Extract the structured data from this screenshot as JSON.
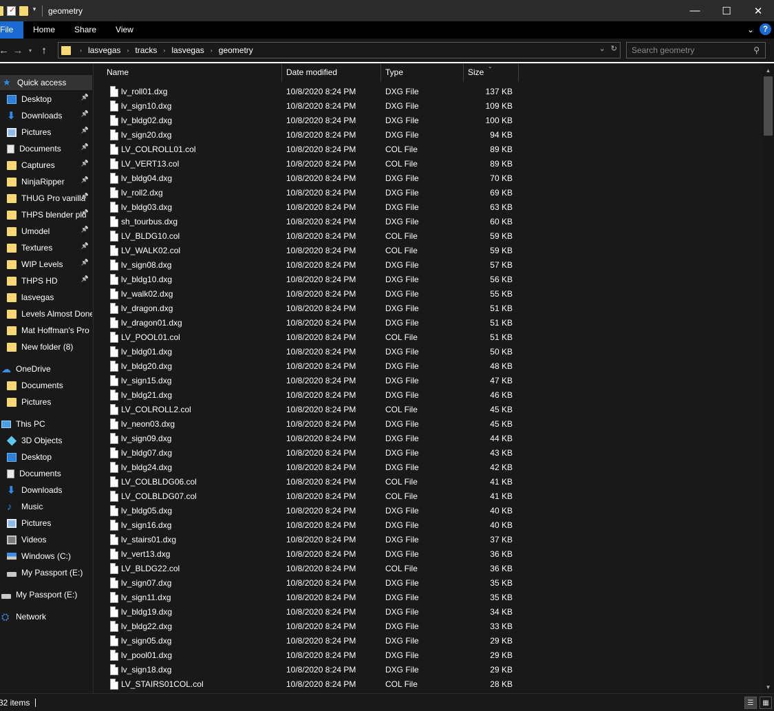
{
  "window": {
    "title": "geometry",
    "controls": {
      "minimize": "—",
      "maximize": "☐",
      "close": "✕"
    }
  },
  "ribbon": {
    "tabs": [
      "File",
      "Home",
      "Share",
      "View"
    ],
    "expand_icon": "chevron-down-icon",
    "help_label": "?"
  },
  "navigation": {
    "breadcrumb": [
      "lasvegas",
      "tracks",
      "lasvegas",
      "geometry"
    ],
    "search_placeholder": "Search geometry"
  },
  "sidebar": {
    "quick_access": {
      "label": "Quick access",
      "items": [
        {
          "label": "Desktop",
          "icon": "desktop",
          "pinned": true
        },
        {
          "label": "Downloads",
          "icon": "down",
          "pinned": true
        },
        {
          "label": "Pictures",
          "icon": "pic",
          "pinned": true
        },
        {
          "label": "Documents",
          "icon": "doc",
          "pinned": true
        },
        {
          "label": "Captures",
          "icon": "folder",
          "pinned": true
        },
        {
          "label": "NinjaRipper",
          "icon": "folder",
          "pinned": true
        },
        {
          "label": "THUG Pro vanilla",
          "icon": "folder",
          "pinned": true
        },
        {
          "label": "THPS blender plu",
          "icon": "folder",
          "pinned": true
        },
        {
          "label": "Umodel",
          "icon": "folder",
          "pinned": true
        },
        {
          "label": "Textures",
          "icon": "folder",
          "pinned": true
        },
        {
          "label": "WIP Levels",
          "icon": "folder",
          "pinned": true
        },
        {
          "label": "THPS HD",
          "icon": "folder",
          "pinned": true
        },
        {
          "label": "lasvegas",
          "icon": "folder",
          "pinned": false
        },
        {
          "label": "Levels Almost Done",
          "icon": "folder",
          "pinned": false
        },
        {
          "label": "Mat Hoffman's Pro",
          "icon": "folder",
          "pinned": false
        },
        {
          "label": "New folder (8)",
          "icon": "folder",
          "pinned": false
        }
      ]
    },
    "onedrive": {
      "label": "OneDrive",
      "items": [
        {
          "label": "Documents",
          "icon": "folder"
        },
        {
          "label": "Pictures",
          "icon": "folder"
        }
      ]
    },
    "this_pc": {
      "label": "This PC",
      "items": [
        {
          "label": "3D Objects",
          "icon": "cube"
        },
        {
          "label": "Desktop",
          "icon": "desktop"
        },
        {
          "label": "Documents",
          "icon": "doc"
        },
        {
          "label": "Downloads",
          "icon": "down"
        },
        {
          "label": "Music",
          "icon": "music"
        },
        {
          "label": "Pictures",
          "icon": "pic"
        },
        {
          "label": "Videos",
          "icon": "video"
        },
        {
          "label": "Windows (C:)",
          "icon": "winc"
        },
        {
          "label": "My Passport (E:)",
          "icon": "drive"
        }
      ]
    },
    "passport": {
      "label": "My Passport (E:)"
    },
    "network": {
      "label": "Network"
    }
  },
  "columns": {
    "name": "Name",
    "date": "Date modified",
    "type": "Type",
    "size": "Size"
  },
  "files": [
    {
      "name": "lv_roll01.dxg",
      "date": "10/8/2020 8:24 PM",
      "type": "DXG File",
      "size": "137 KB"
    },
    {
      "name": "lv_sign10.dxg",
      "date": "10/8/2020 8:24 PM",
      "type": "DXG File",
      "size": "109 KB"
    },
    {
      "name": "lv_bldg02.dxg",
      "date": "10/8/2020 8:24 PM",
      "type": "DXG File",
      "size": "100 KB"
    },
    {
      "name": "lv_sign20.dxg",
      "date": "10/8/2020 8:24 PM",
      "type": "DXG File",
      "size": "94 KB"
    },
    {
      "name": "LV_COLROLL01.col",
      "date": "10/8/2020 8:24 PM",
      "type": "COL File",
      "size": "89 KB"
    },
    {
      "name": "LV_VERT13.col",
      "date": "10/8/2020 8:24 PM",
      "type": "COL File",
      "size": "89 KB"
    },
    {
      "name": "lv_bldg04.dxg",
      "date": "10/8/2020 8:24 PM",
      "type": "DXG File",
      "size": "70 KB"
    },
    {
      "name": "lv_roll2.dxg",
      "date": "10/8/2020 8:24 PM",
      "type": "DXG File",
      "size": "69 KB"
    },
    {
      "name": "lv_bldg03.dxg",
      "date": "10/8/2020 8:24 PM",
      "type": "DXG File",
      "size": "63 KB"
    },
    {
      "name": "sh_tourbus.dxg",
      "date": "10/8/2020 8:24 PM",
      "type": "DXG File",
      "size": "60 KB"
    },
    {
      "name": "LV_BLDG10.col",
      "date": "10/8/2020 8:24 PM",
      "type": "COL File",
      "size": "59 KB"
    },
    {
      "name": "LV_WALK02.col",
      "date": "10/8/2020 8:24 PM",
      "type": "COL File",
      "size": "59 KB"
    },
    {
      "name": "lv_sign08.dxg",
      "date": "10/8/2020 8:24 PM",
      "type": "DXG File",
      "size": "57 KB"
    },
    {
      "name": "lv_bldg10.dxg",
      "date": "10/8/2020 8:24 PM",
      "type": "DXG File",
      "size": "56 KB"
    },
    {
      "name": "lv_walk02.dxg",
      "date": "10/8/2020 8:24 PM",
      "type": "DXG File",
      "size": "55 KB"
    },
    {
      "name": "lv_dragon.dxg",
      "date": "10/8/2020 8:24 PM",
      "type": "DXG File",
      "size": "51 KB"
    },
    {
      "name": "lv_dragon01.dxg",
      "date": "10/8/2020 8:24 PM",
      "type": "DXG File",
      "size": "51 KB"
    },
    {
      "name": "LV_POOL01.col",
      "date": "10/8/2020 8:24 PM",
      "type": "COL File",
      "size": "51 KB"
    },
    {
      "name": "lv_bldg01.dxg",
      "date": "10/8/2020 8:24 PM",
      "type": "DXG File",
      "size": "50 KB"
    },
    {
      "name": "lv_bldg20.dxg",
      "date": "10/8/2020 8:24 PM",
      "type": "DXG File",
      "size": "48 KB"
    },
    {
      "name": "lv_sign15.dxg",
      "date": "10/8/2020 8:24 PM",
      "type": "DXG File",
      "size": "47 KB"
    },
    {
      "name": "lv_bldg21.dxg",
      "date": "10/8/2020 8:24 PM",
      "type": "DXG File",
      "size": "46 KB"
    },
    {
      "name": "LV_COLROLL2.col",
      "date": "10/8/2020 8:24 PM",
      "type": "COL File",
      "size": "45 KB"
    },
    {
      "name": "lv_neon03.dxg",
      "date": "10/8/2020 8:24 PM",
      "type": "DXG File",
      "size": "45 KB"
    },
    {
      "name": "lv_sign09.dxg",
      "date": "10/8/2020 8:24 PM",
      "type": "DXG File",
      "size": "44 KB"
    },
    {
      "name": "lv_bldg07.dxg",
      "date": "10/8/2020 8:24 PM",
      "type": "DXG File",
      "size": "43 KB"
    },
    {
      "name": "lv_bldg24.dxg",
      "date": "10/8/2020 8:24 PM",
      "type": "DXG File",
      "size": "42 KB"
    },
    {
      "name": "LV_COLBLDG06.col",
      "date": "10/8/2020 8:24 PM",
      "type": "COL File",
      "size": "41 KB"
    },
    {
      "name": "LV_COLBLDG07.col",
      "date": "10/8/2020 8:24 PM",
      "type": "COL File",
      "size": "41 KB"
    },
    {
      "name": "lv_bldg05.dxg",
      "date": "10/8/2020 8:24 PM",
      "type": "DXG File",
      "size": "40 KB"
    },
    {
      "name": "lv_sign16.dxg",
      "date": "10/8/2020 8:24 PM",
      "type": "DXG File",
      "size": "40 KB"
    },
    {
      "name": "lv_stairs01.dxg",
      "date": "10/8/2020 8:24 PM",
      "type": "DXG File",
      "size": "37 KB"
    },
    {
      "name": "lv_vert13.dxg",
      "date": "10/8/2020 8:24 PM",
      "type": "DXG File",
      "size": "36 KB"
    },
    {
      "name": "LV_BLDG22.col",
      "date": "10/8/2020 8:24 PM",
      "type": "COL File",
      "size": "36 KB"
    },
    {
      "name": "lv_sign07.dxg",
      "date": "10/8/2020 8:24 PM",
      "type": "DXG File",
      "size": "35 KB"
    },
    {
      "name": "lv_sign11.dxg",
      "date": "10/8/2020 8:24 PM",
      "type": "DXG File",
      "size": "35 KB"
    },
    {
      "name": "lv_bldg19.dxg",
      "date": "10/8/2020 8:24 PM",
      "type": "DXG File",
      "size": "34 KB"
    },
    {
      "name": "lv_bldg22.dxg",
      "date": "10/8/2020 8:24 PM",
      "type": "DXG File",
      "size": "33 KB"
    },
    {
      "name": "lv_sign05.dxg",
      "date": "10/8/2020 8:24 PM",
      "type": "DXG File",
      "size": "29 KB"
    },
    {
      "name": "lv_pool01.dxg",
      "date": "10/8/2020 8:24 PM",
      "type": "DXG File",
      "size": "29 KB"
    },
    {
      "name": "lv_sign18.dxg",
      "date": "10/8/2020 8:24 PM",
      "type": "DXG File",
      "size": "29 KB"
    },
    {
      "name": "LV_STAIRS01COL.col",
      "date": "10/8/2020 8:24 PM",
      "type": "COL File",
      "size": "28 KB"
    }
  ],
  "status": {
    "item_count": "32 items"
  },
  "colors": {
    "accent": "#1a6ad1",
    "background": "#191919",
    "folder": "#f8d775"
  }
}
